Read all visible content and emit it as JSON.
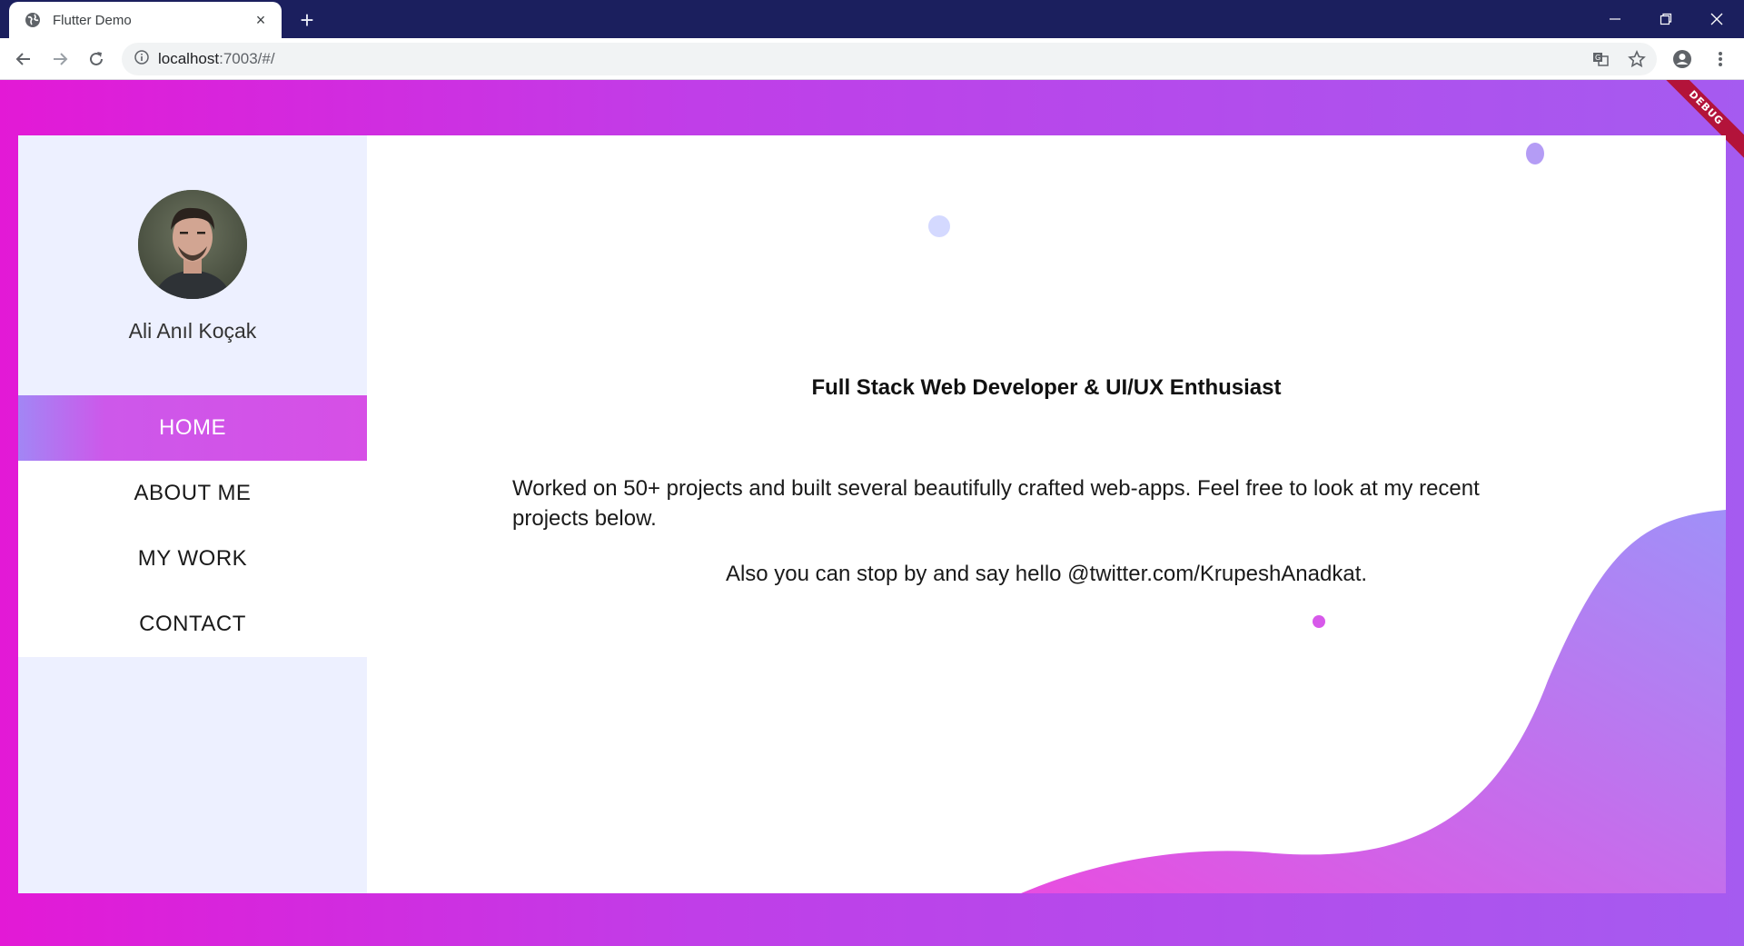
{
  "browser": {
    "tab_title": "Flutter Demo",
    "tab_close": "×",
    "new_tab": "+",
    "url_host": "localhost",
    "url_path": ":7003/#/"
  },
  "profile": {
    "name": "Ali Anıl Koçak"
  },
  "menu": {
    "items": [
      {
        "label": "HOME",
        "active": true
      },
      {
        "label": "ABOUT ME",
        "active": false
      },
      {
        "label": "MY WORK",
        "active": false
      },
      {
        "label": "CONTACT",
        "active": false
      }
    ]
  },
  "hero": {
    "headline": "Full Stack Web Developer & UI/UX Enthusiast",
    "paragraph1": "Worked on 50+ projects and built several beautifully crafted web-apps. Feel free to look at my recent projects below.",
    "paragraph2": "Also you can stop by and say hello @twitter.com/KrupeshAnadkat."
  },
  "debug_banner": "DEBUG",
  "colors": {
    "titlebar": "#1b1f5e",
    "gradient_start": "#e319d6",
    "gradient_end": "#a55bf0",
    "sidebar_bg": "#edf0ff",
    "active_menu": "#d64fe6",
    "wave_left": "#e84de0",
    "wave_right": "#a090f8"
  },
  "icons": {
    "favicon": "globe-icon",
    "back": "arrow-left-icon",
    "forward": "arrow-right-icon",
    "reload": "reload-icon",
    "info": "info-icon",
    "translate": "translate-icon",
    "bookmark": "star-icon",
    "account": "account-icon",
    "menu": "kebab-menu-icon"
  }
}
